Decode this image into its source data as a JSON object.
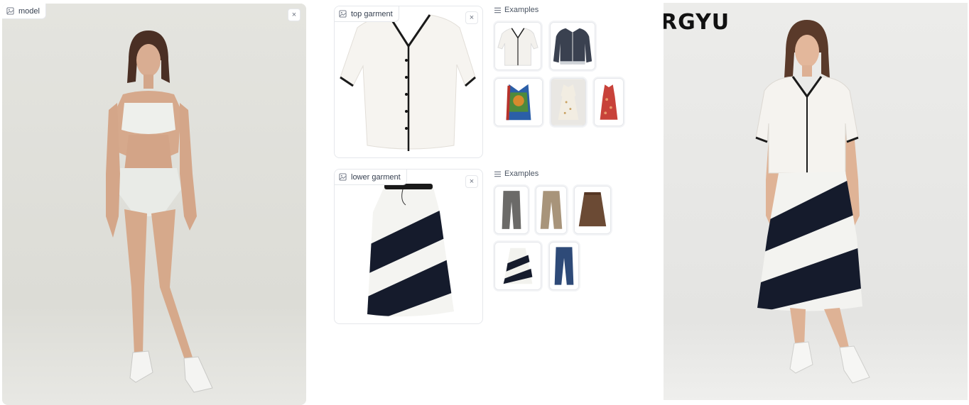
{
  "model_panel": {
    "label": "model",
    "close": "×"
  },
  "top_panel": {
    "label": "top garment",
    "close": "×"
  },
  "lower_panel": {
    "label": "lower garment",
    "close": "×"
  },
  "top_examples": {
    "heading": "Examples",
    "items": [
      "white-v-neck-blouse",
      "navy-polo-cardigan",
      "graphic-print-vest",
      "floral-shirt-dress",
      "red-floral-dress"
    ]
  },
  "lower_examples": {
    "heading": "Examples",
    "items": [
      "grey-trousers",
      "beige-trousers",
      "brown-leather-skirt",
      "striped-skirt",
      "blue-jeans"
    ]
  },
  "output": {
    "watermark": "RGYU"
  }
}
